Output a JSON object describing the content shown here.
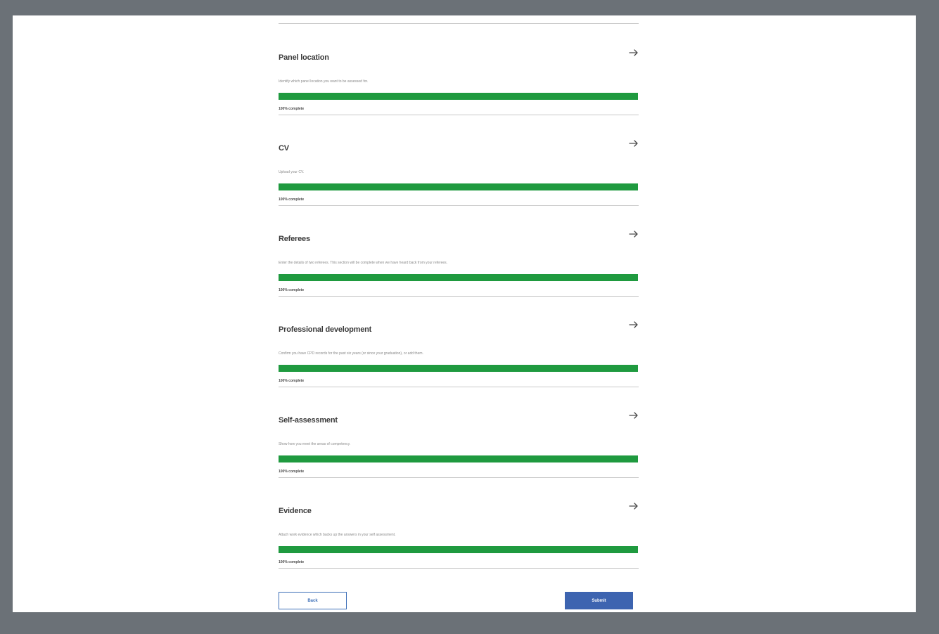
{
  "sections": [
    {
      "title": "Panel location",
      "description": "Identify which panel location you want to be assessed for.",
      "progress_label": "100% complete",
      "progress": 1.0
    },
    {
      "title": "CV",
      "description": "Upload your CV.",
      "progress_label": "100% complete",
      "progress": 1.0
    },
    {
      "title": "Referees",
      "description": "Enter the details of two referees. This section will be complete when we have heard back from your referees.",
      "progress_label": "100% complete",
      "progress": 1.0
    },
    {
      "title": "Professional development",
      "description": "Confirm you have CPD records for the past six years (or since your graduation), or add them.",
      "progress_label": "100% complete",
      "progress": 1.0
    },
    {
      "title": "Self-assessment",
      "description": "Show how you meet the areas of competency.",
      "progress_label": "100% complete",
      "progress": 1.0
    },
    {
      "title": "Evidence",
      "description": "Attach work evidence which backs up the answers in your self assessment.",
      "progress_label": "100% complete",
      "progress": 1.0
    }
  ],
  "actions": {
    "back_label": "Back",
    "submit_label": "Submit"
  },
  "colors": {
    "progress_fill": "#1f9a3f",
    "primary": "#3d64b0",
    "frame": "#6b7177"
  },
  "icons": {
    "section_link": "arrow-right-icon"
  }
}
